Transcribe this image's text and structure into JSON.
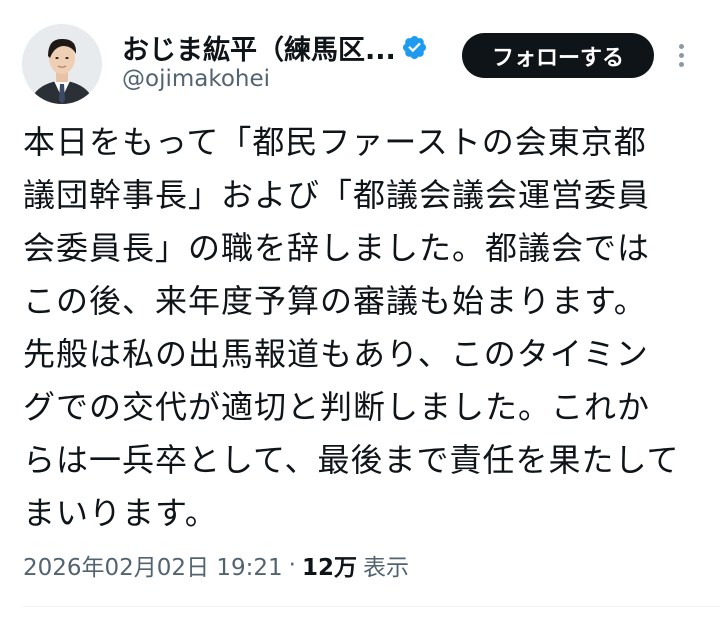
{
  "author": {
    "display_name": "おじま紘平（練馬区...",
    "handle": "@ojimakohei",
    "verified": true
  },
  "follow_button": {
    "label": "フォローする"
  },
  "tweet": {
    "lines": [
      "本日をもって「都民ファーストの会東京都",
      "議団幹事長」および「都議会議会運営委員",
      "会委員長」の職を辞しました。都議会では",
      "この後、来年度予算の審議も始まります。",
      "先般は私の出馬報道もあり、このタイミン",
      "グでの交代が適切と判断しました。これか",
      "らは一兵卒として、最後まで責任を果たして",
      "まいります。"
    ]
  },
  "meta": {
    "timestamp": "2026年02月02日 19:21",
    "separator": "·",
    "views_count": "12万",
    "views_label": "表示"
  },
  "colors": {
    "text_primary": "#0f1419",
    "text_secondary": "#536471",
    "verified_badge": "#1d9bf0",
    "follow_button_bg": "#0f1419",
    "follow_button_text": "#ffffff",
    "divider": "#eff3f4"
  },
  "icons": {
    "verified": "verified-badge-icon",
    "more": "more-options-icon"
  }
}
